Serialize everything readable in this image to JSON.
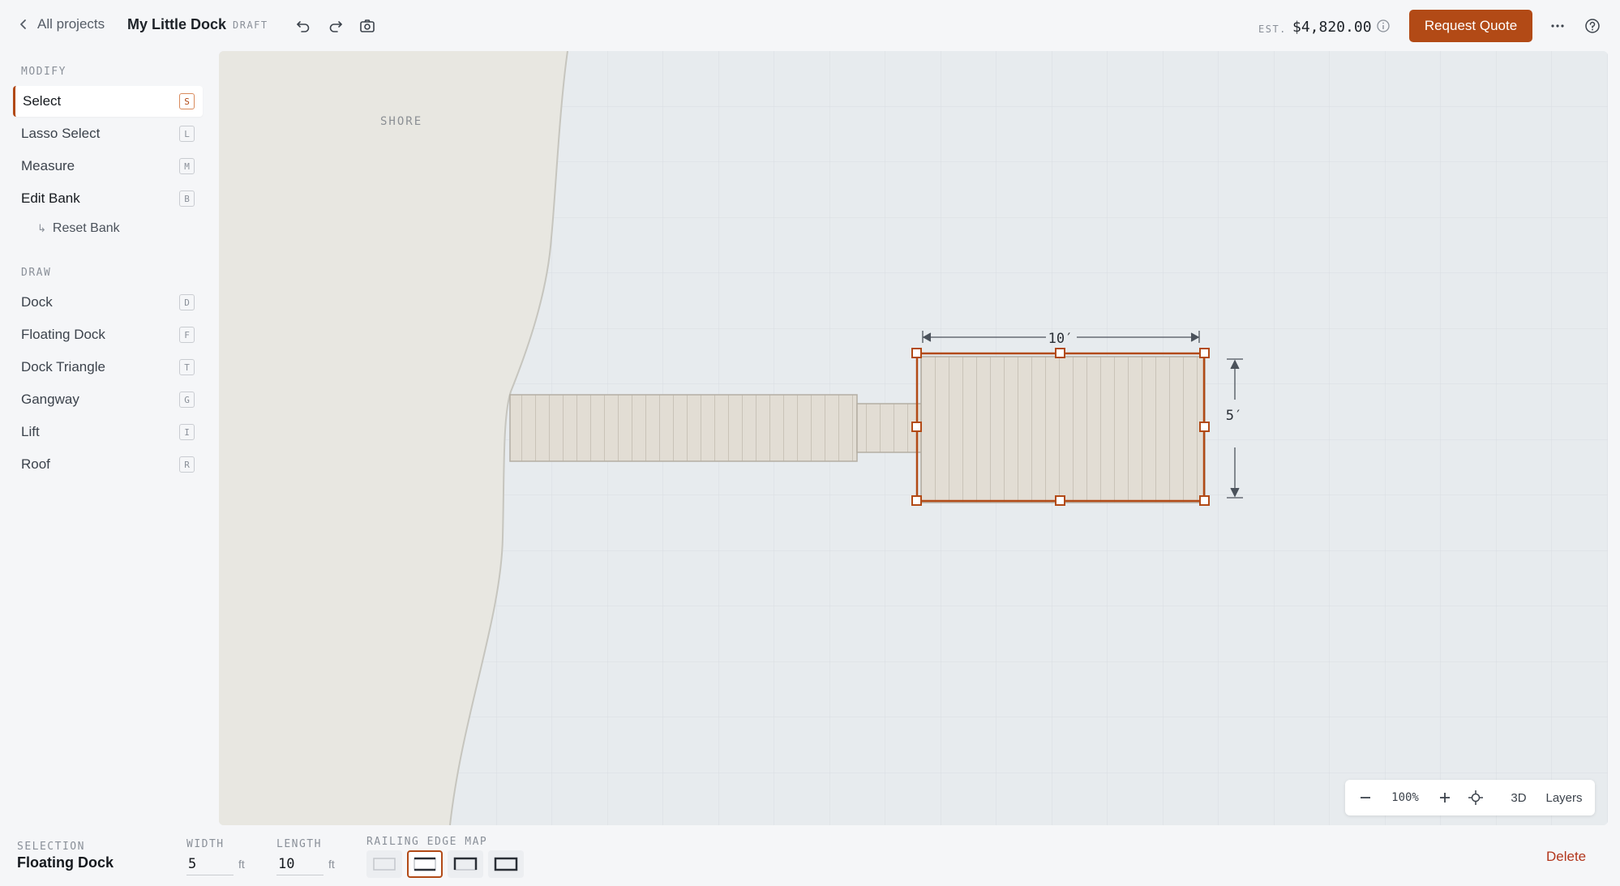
{
  "topbar": {
    "back_label": "All projects",
    "project_title": "My Little Dock",
    "status": "DRAFT",
    "icons": [
      "undo-icon",
      "redo-icon",
      "camera-icon"
    ],
    "estimate_label": "EST.",
    "estimate_value": "$4,820.00",
    "request_quote_label": "Request Quote"
  },
  "sidebar": {
    "modify_label": "MODIFY",
    "modify_items": [
      {
        "label": "Select",
        "key": "S",
        "active": true
      },
      {
        "label": "Lasso Select",
        "key": "L"
      },
      {
        "label": "Measure",
        "key": "M"
      },
      {
        "label": "Edit Bank",
        "key": "B"
      }
    ],
    "sub_item": "Reset Bank",
    "draw_label": "DRAW",
    "draw_items": [
      {
        "label": "Dock",
        "key": "D"
      },
      {
        "label": "Floating Dock",
        "key": "F"
      },
      {
        "label": "Dock Triangle",
        "key": "T"
      },
      {
        "label": "Gangway",
        "key": "G"
      },
      {
        "label": "Lift",
        "key": "I"
      },
      {
        "label": "Roof",
        "key": "R"
      }
    ]
  },
  "canvas": {
    "shore_label": "SHORE",
    "dim_width": "10′",
    "dim_height": "5′",
    "colors": {
      "accent": "#b24a16",
      "water": "#e7ebee",
      "shore": "#e8e7e1",
      "deck": "#e2ddd4"
    }
  },
  "zoom": {
    "level": "100%",
    "view_3d": "3D",
    "layers": "Layers"
  },
  "bottombar": {
    "selection_label": "SELECTION",
    "selection_value": "Floating Dock",
    "width_label": "WIDTH",
    "width_value": "5",
    "width_unit": "ft",
    "length_label": "LENGTH",
    "length_value": "10",
    "length_unit": "ft",
    "railing_label": "RAILING EDGE MAP",
    "delete_label": "Delete"
  }
}
